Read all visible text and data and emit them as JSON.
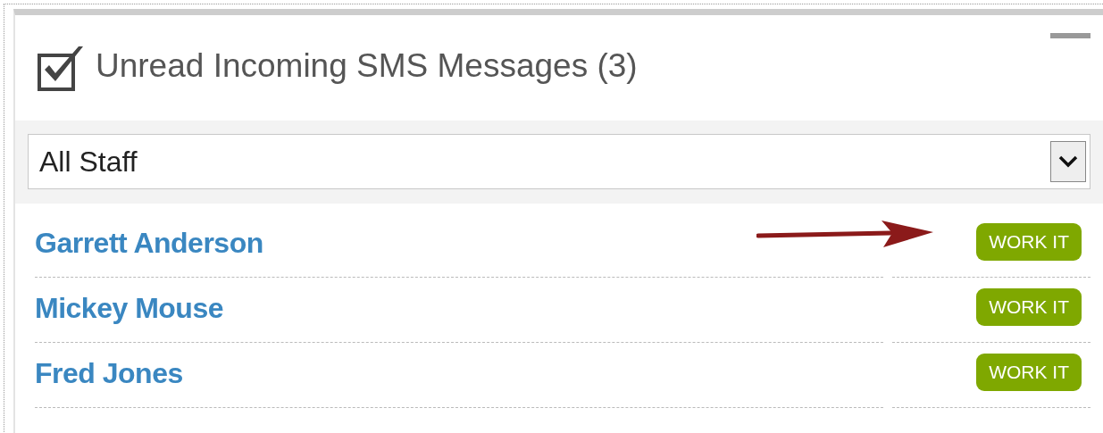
{
  "widget": {
    "title": "Unread Incoming SMS Messages (3)"
  },
  "filter": {
    "value": "All Staff"
  },
  "messages": [
    {
      "name": "Garrett Anderson",
      "action": "WORK IT",
      "arrow": true
    },
    {
      "name": "Mickey Mouse",
      "action": "WORK IT",
      "arrow": false
    },
    {
      "name": "Fred Jones",
      "action": "WORK IT",
      "arrow": false
    }
  ]
}
